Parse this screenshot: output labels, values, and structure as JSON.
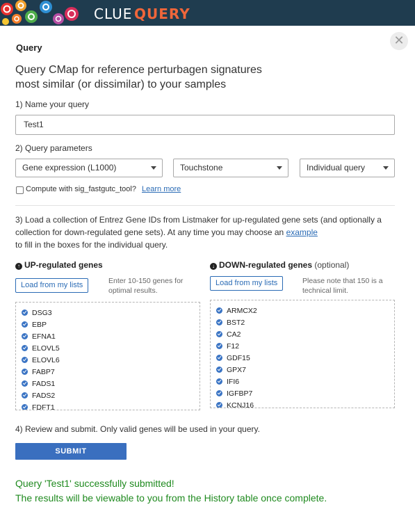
{
  "header": {
    "brand_primary": "CLUE",
    "brand_secondary": "QUERY",
    "colors": {
      "bar": "#1f3c4f",
      "accent": "#f0663a"
    }
  },
  "panel": {
    "title": "Query",
    "close_icon": "close-icon",
    "headline_line1": "Query CMap for reference perturbagen signatures",
    "headline_line2": "most similar (or dissimilar) to your samples"
  },
  "step1": {
    "label": "1) Name your query",
    "query_name": "Test1"
  },
  "step2": {
    "label": "2) Query parameters",
    "data_type": "Gene expression (L1000)",
    "dataset": "Touchstone",
    "query_mode": "Individual query",
    "fastgutc_label": "Compute with sig_fastgutc_tool?",
    "fastgutc_checked": false,
    "learn_more": "Learn more"
  },
  "step3": {
    "text_before_link": "3) Load a collection of Entrez Gene IDs from Listmaker for up-regulated gene sets (and optionally a collection for down-regulated gene sets). At any time you may choose an",
    "link": "example",
    "text_after_link": "to fill in the boxes for the individual query."
  },
  "up": {
    "icon": "arrow-up-circle-icon",
    "title": "UP-regulated genes",
    "load_button": "Load from my lists",
    "hint": "Enter 10-150 genes for optimal results.",
    "genes": [
      "DSG3",
      "EBP",
      "EFNA1",
      "ELOVL5",
      "ELOVL6",
      "FABP7",
      "FADS1",
      "FADS2",
      "FDFT1"
    ]
  },
  "down": {
    "icon": "arrow-down-circle-icon",
    "title": "DOWN-regulated genes",
    "optional": "(optional)",
    "load_button": "Load from my lists",
    "hint": "Please note that 150 is a technical limit.",
    "genes": [
      "ARMCX2",
      "BST2",
      "CA2",
      "F12",
      "GDF15",
      "GPX7",
      "IFI6",
      "IGFBP7",
      "KCNJ16"
    ]
  },
  "step4": {
    "label": "4) Review and submit. Only valid genes will be used in your query.",
    "submit": "SUBMIT"
  },
  "status": {
    "line1": "Query 'Test1' successfully submitted!",
    "line2": "The results will be viewable to you from the History table once complete.",
    "color": "#1f8a1f"
  }
}
